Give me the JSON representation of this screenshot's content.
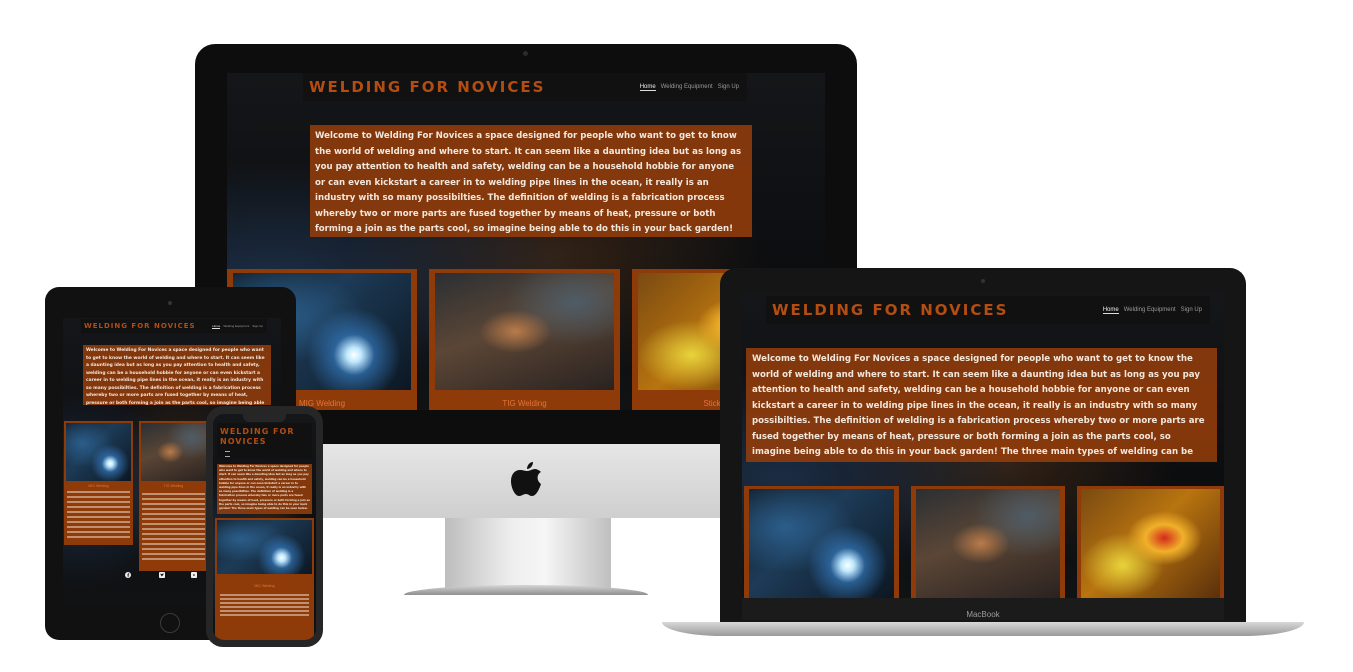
{
  "site": {
    "brand": "WELDING FOR NOVICES",
    "nav": [
      {
        "label": "Home",
        "active": true
      },
      {
        "label": "Welding Equipment",
        "active": false
      },
      {
        "label": "Sign Up",
        "active": false
      }
    ],
    "intro": "Welcome to Welding For Novices a space designed for people who want to get to know the world of welding and where to start. It can seem like a daunting idea but as long as you pay attention to health and safety, welding can be a household hobbie for anyone or can even kickstart a career in to welding pipe lines in the ocean, it really is an industry with so many possibilties. The definition of welding is a fabrication process whereby two or more parts are fused together by means of heat, pressure or both forming a join as the parts cool, so imagine being able to do this in your back garden! The three main types of welding can be seen below.",
    "cards": [
      {
        "caption": "MIG Welding",
        "photo": "mig-welding-photo"
      },
      {
        "caption": "TIG Welding",
        "photo": "tig-welding-photo"
      },
      {
        "caption": "Stick Welding",
        "photo": "stick-welding-photo"
      }
    ]
  },
  "devices": {
    "laptop_label": "MacBook"
  },
  "colors": {
    "brand": "#b34d12",
    "panel": "#8f3b09",
    "background": "#0b0b0c"
  },
  "icons": [
    "apple-logo-icon",
    "facebook-icon",
    "twitter-icon",
    "youtube-icon",
    "hamburger-icon"
  ]
}
